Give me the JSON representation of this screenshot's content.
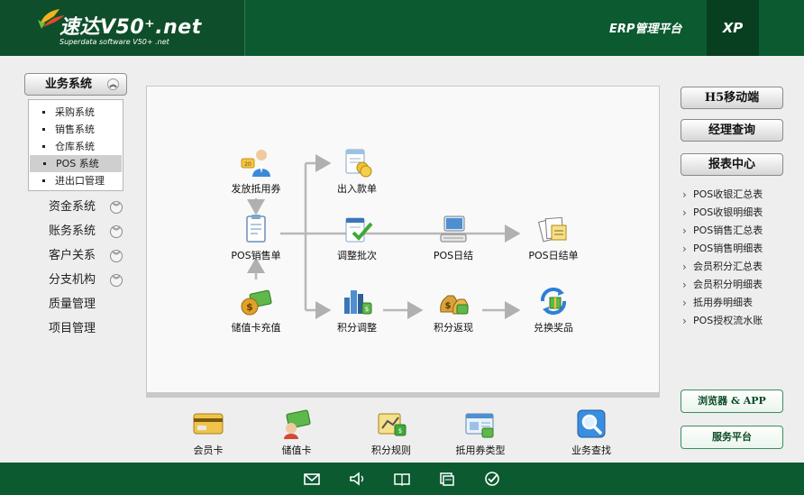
{
  "header": {
    "logo_title": "速达V50⁺.net",
    "logo_subtitle": "Superdata software V50+ .net",
    "platform": "ERP管理平台",
    "edition": "XP"
  },
  "sidebar": {
    "system_button": "业务系统",
    "sub_items": [
      {
        "label": "采购系统"
      },
      {
        "label": "销售系统"
      },
      {
        "label": "仓库系统"
      },
      {
        "label": "POS 系统",
        "active": true
      },
      {
        "label": "进出口管理"
      }
    ],
    "nav_items": [
      {
        "label": "资金系统",
        "expandable": true
      },
      {
        "label": "账务系统",
        "expandable": true
      },
      {
        "label": "客户关系",
        "expandable": true
      },
      {
        "label": "分支机构",
        "expandable": true
      },
      {
        "label": "质量管理",
        "expandable": false
      },
      {
        "label": "项目管理",
        "expandable": false
      }
    ]
  },
  "workflow": {
    "nodes": {
      "issue_voucher": {
        "label": "发放抵用券",
        "icon": "person-voucher-icon"
      },
      "pos_sale": {
        "label": "POS销售单",
        "icon": "clipboard-icon"
      },
      "card_recharge": {
        "label": "储值卡充值",
        "icon": "money-card-icon"
      },
      "cash_in_out": {
        "label": "出入款单",
        "icon": "coins-document-icon"
      },
      "adjust_batch": {
        "label": "调整批次",
        "icon": "check-document-icon"
      },
      "points_adjust": {
        "label": "积分调整",
        "icon": "city-chart-icon"
      },
      "pos_daily": {
        "label": "POS日结",
        "icon": "computer-icon"
      },
      "points_cashback": {
        "label": "积分返现",
        "icon": "money-bags-icon"
      },
      "pos_daily_bill": {
        "label": "POS日结单",
        "icon": "documents-icon"
      },
      "redeem_prize": {
        "label": "兑换奖品",
        "icon": "refresh-gift-icon"
      }
    }
  },
  "bottom_bar": {
    "items": [
      {
        "label": "会员卡",
        "icon": "member-card-icon"
      },
      {
        "label": "储值卡",
        "icon": "stored-value-card-icon"
      },
      {
        "label": "积分规则",
        "icon": "points-rule-icon"
      },
      {
        "label": "抵用券类型",
        "icon": "voucher-type-icon"
      },
      {
        "label": "业务查找",
        "icon": "magnifier-icon"
      }
    ]
  },
  "right_panel": {
    "buttons": [
      "H5移动端",
      "经理查询",
      "报表中心"
    ],
    "reports": [
      "POS收银汇总表",
      "POS收银明细表",
      "POS销售汇总表",
      "POS销售明细表",
      "会员积分汇总表",
      "会员积分明细表",
      "抵用券明细表",
      "POS授权流水账"
    ],
    "browser_button": "浏览器 & APP",
    "service_button": "服务平台"
  },
  "footer": {
    "icons": [
      "mail-icon",
      "speaker-icon",
      "book-icon",
      "window-icon",
      "check-circle-icon"
    ]
  },
  "colors": {
    "header_green": "#0b5a30",
    "accent_green": "#3d8f5c"
  }
}
